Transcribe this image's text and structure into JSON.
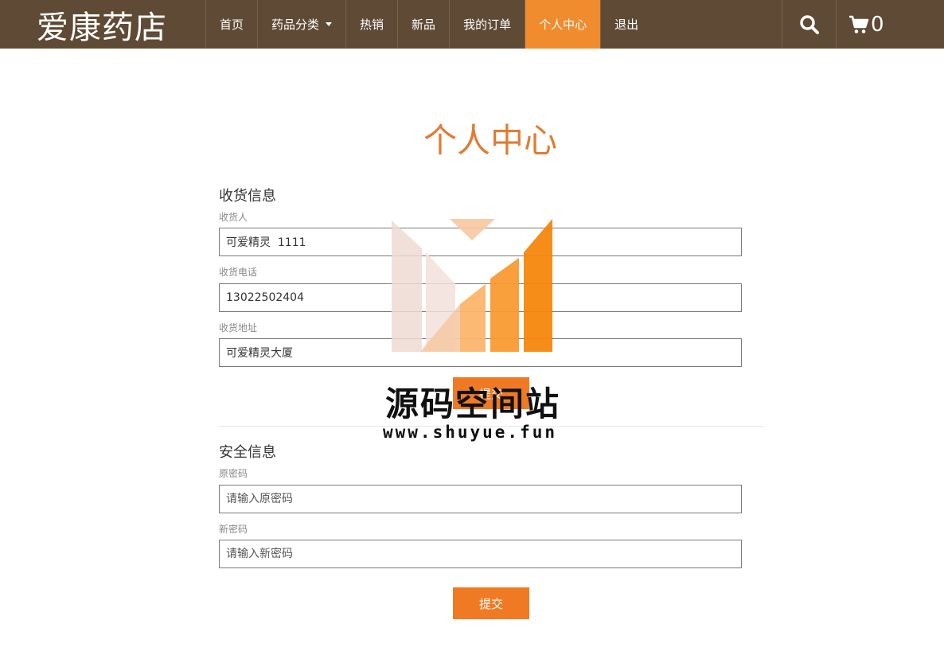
{
  "brand": "爱康药店",
  "nav": {
    "items": [
      {
        "label": "首页"
      },
      {
        "label": "药品分类"
      },
      {
        "label": "热销"
      },
      {
        "label": "新品"
      },
      {
        "label": "我的订单"
      },
      {
        "label": "个人中心"
      },
      {
        "label": "退出"
      }
    ],
    "active": "个人中心",
    "cart_count": "0",
    "icons": [
      "search-icon",
      "cart-icon",
      "caret-down-icon"
    ]
  },
  "page": {
    "title": "个人中心"
  },
  "shipping": {
    "section_title": "收货信息",
    "receiver_label": "收货人",
    "receiver_value": "可爱精灵  1111",
    "phone_label": "收货电话",
    "phone_value": "13022502404",
    "address_label": "收货地址",
    "address_value": "可爱精灵大厦",
    "submit_label": "提交"
  },
  "security": {
    "section_title": "安全信息",
    "old_password_label": "原密码",
    "old_password_placeholder": "请输入原密码",
    "new_password_label": "新密码",
    "new_password_placeholder": "请输入新密码",
    "submit_label": "提交"
  },
  "watermark": {
    "title": "源码空间站",
    "url": "www.shuyue.fun"
  },
  "colors": {
    "navbar": "#5f4a35",
    "accent": "#f08c2e",
    "title": "#e07d34"
  }
}
